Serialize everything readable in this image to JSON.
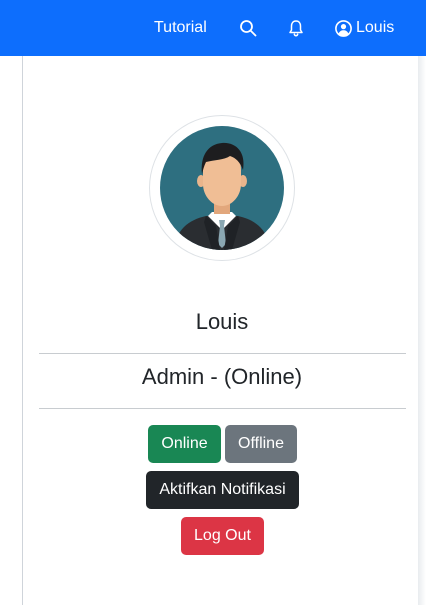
{
  "navbar": {
    "tutorial_label": "Tutorial",
    "search_icon": "search-icon",
    "bell_icon": "bell-icon",
    "user_icon": "user-circle-icon",
    "user_label": "Louis"
  },
  "profile": {
    "name": "Louis",
    "role_status": "Admin - (Online)"
  },
  "buttons": {
    "online": "Online",
    "offline": "Offline",
    "notifications": "Aktifkan Notifikasi",
    "logout": "Log Out"
  },
  "colors": {
    "navbar": "#0d6efd",
    "online": "#198754",
    "offline": "#6c757d",
    "notifications": "#212529",
    "logout": "#dc3545"
  }
}
